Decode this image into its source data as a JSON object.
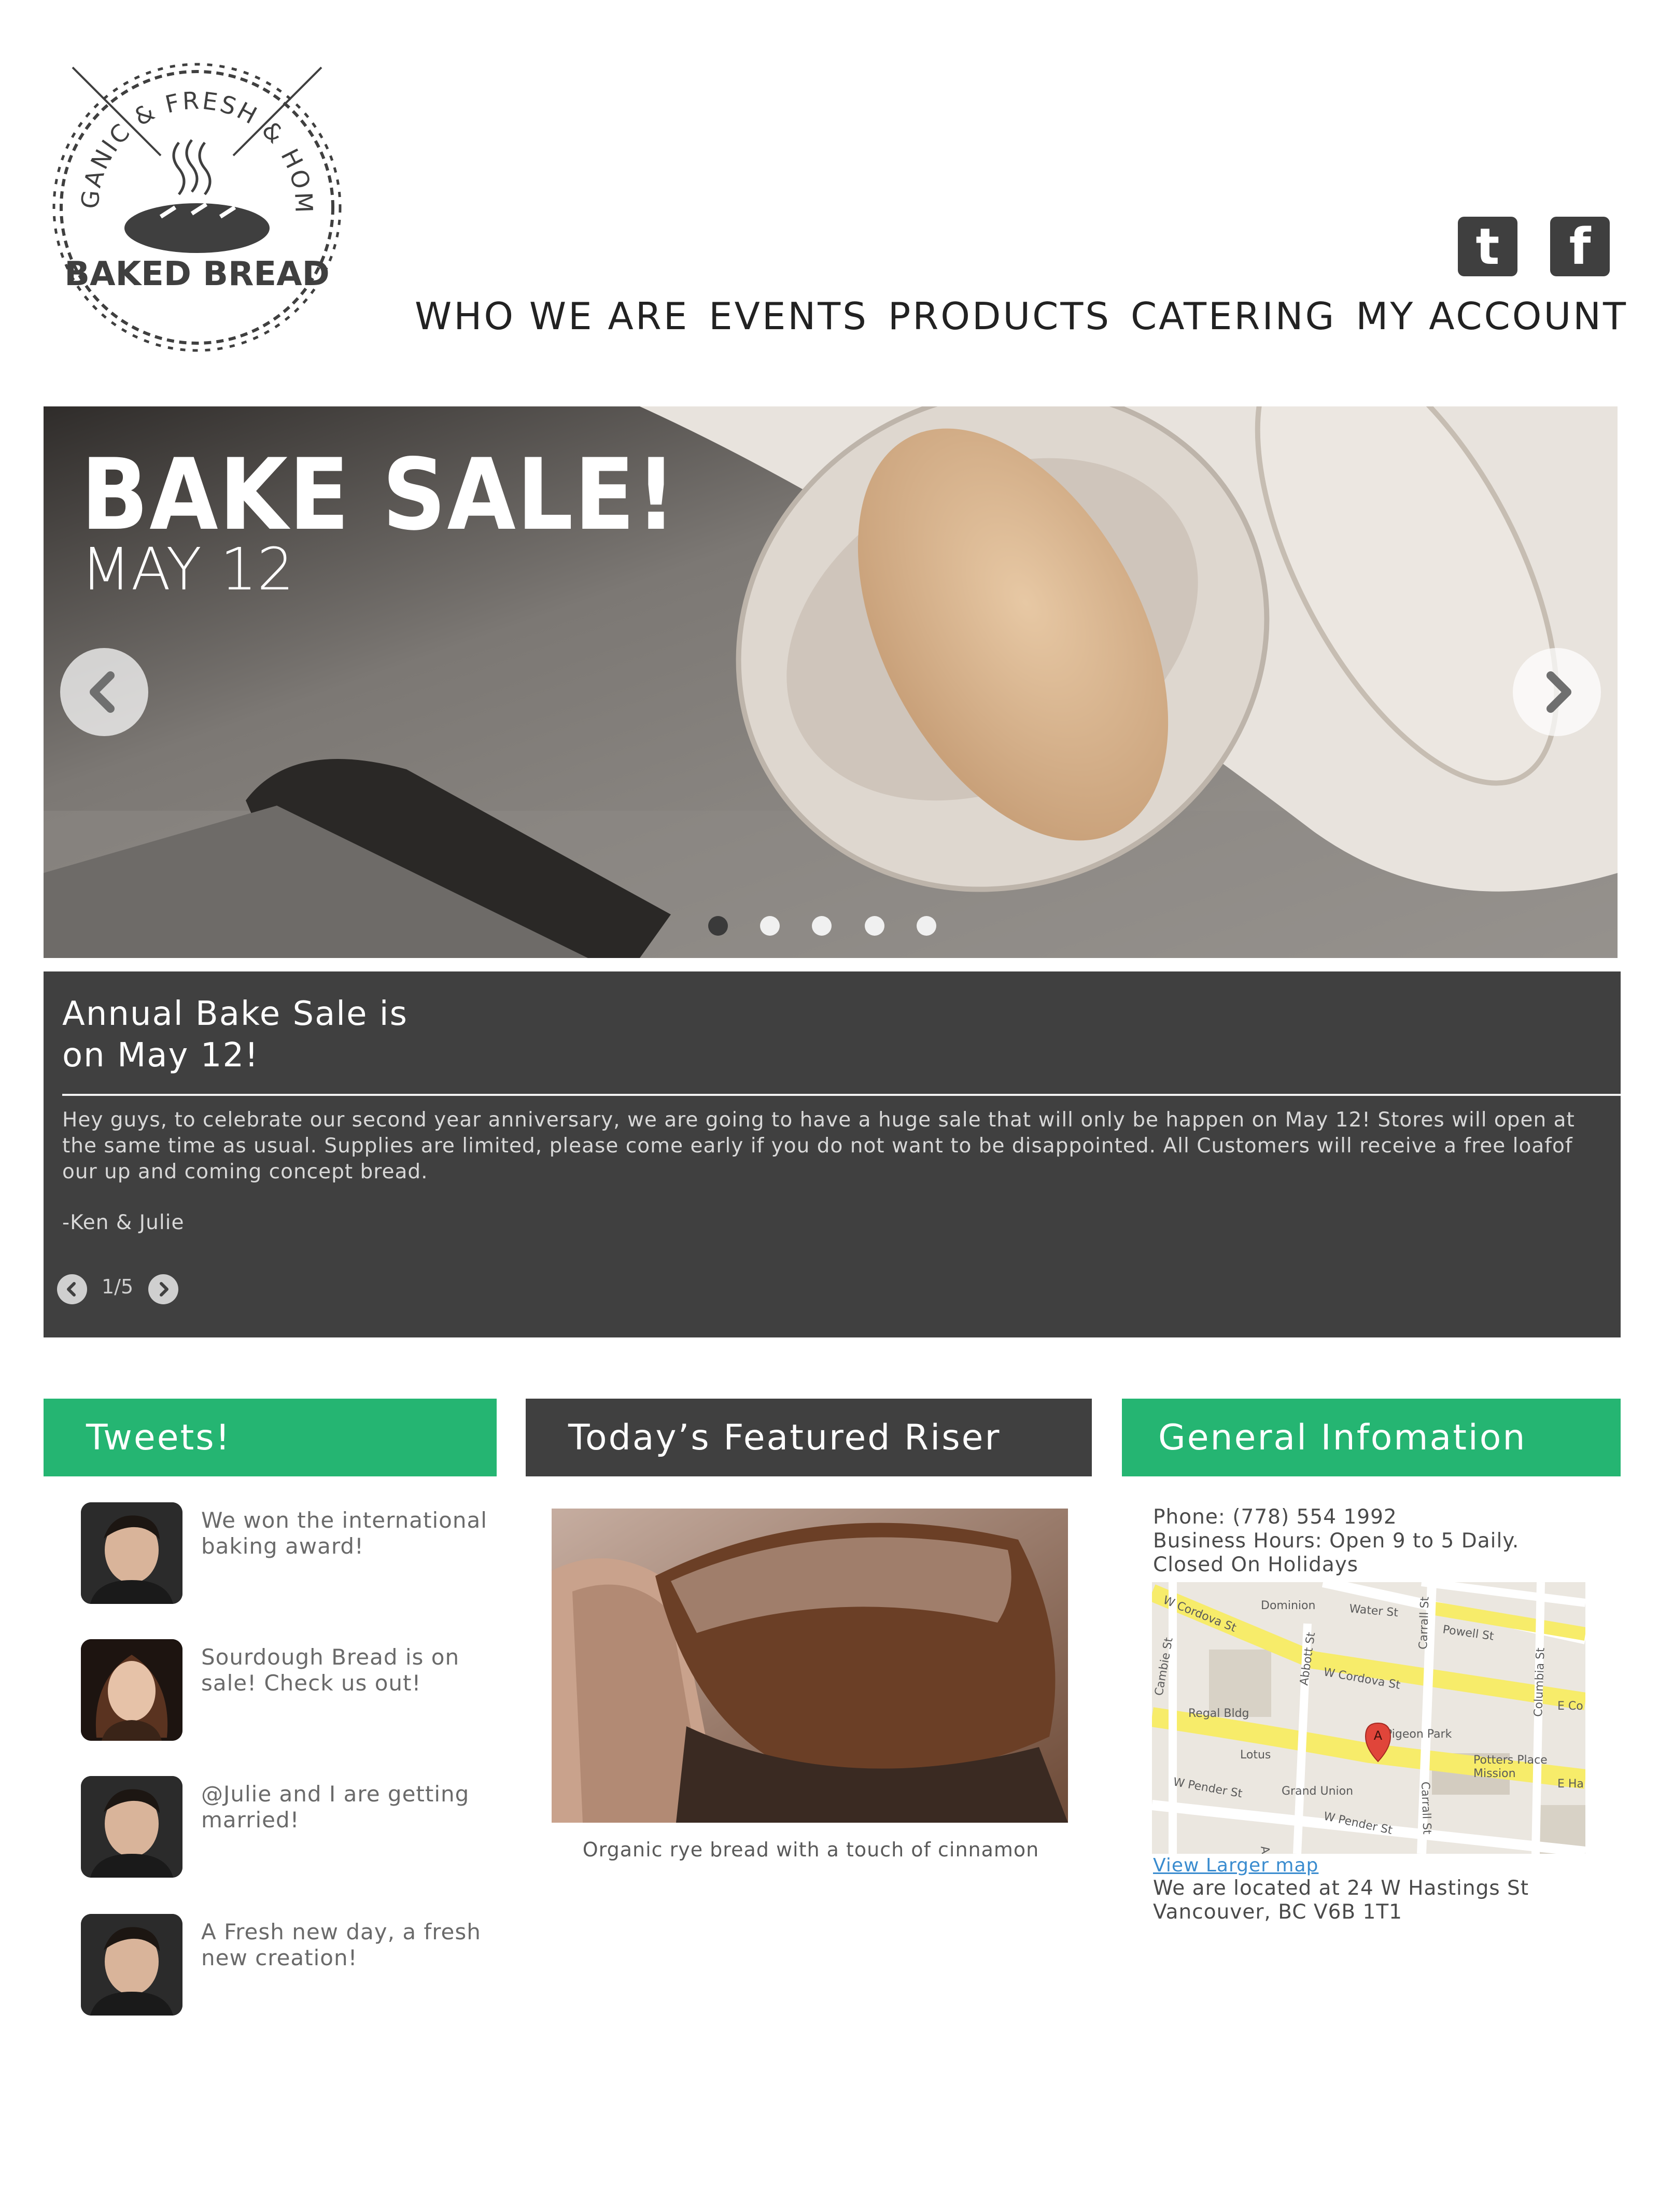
{
  "logo": {
    "arc_text": "ORGANIC & FRESH & HOMEY",
    "name": "BAKED BREAD"
  },
  "social": {
    "twitter_glyph": "t",
    "facebook_glyph": "f"
  },
  "nav": {
    "items": [
      {
        "label": "WHO WE ARE"
      },
      {
        "label": "EVENTS"
      },
      {
        "label": "PRODUCTS"
      },
      {
        "label": "CATERING"
      },
      {
        "label": "MY ACCOUNT"
      }
    ]
  },
  "hero": {
    "title": "BAKE SALE!",
    "date": "MAY 12",
    "slide_count": 5,
    "active_slide": 1
  },
  "news": {
    "title_line1": "Annual Bake Sale is",
    "title_line2": "on May 12!",
    "body": "Hey guys, to celebrate our second year anniversary, we are going to have a huge sale that will only be happen on May 12! Stores will open at the same time as usual. Supplies are limited, please come early if you do not want to be disappointed. All Customers will receive a free loafof our up and coming concept bread.",
    "signature": "-Ken & Julie",
    "counter": "1/5"
  },
  "tweets": {
    "heading": "Tweets!",
    "items": [
      {
        "text": "We won the international baking award!"
      },
      {
        "text": "Sourdough Bread is on sale! Check us out!"
      },
      {
        "text": "@Julie and I are getting married!"
      },
      {
        "text": "A Fresh new day, a fresh new creation!"
      }
    ]
  },
  "featured": {
    "heading": "Today’s Featured Riser",
    "caption": "Organic rye bread with a touch of cinnamon"
  },
  "info": {
    "heading": "General Infomation",
    "phone": "Phone: (778) 554 1992",
    "hours": "Business Hours: Open 9 to 5 Daily.",
    "closed": "Closed On Holidays",
    "map_link": "View Larger map",
    "address_line1": "We are located at 24 W Hastings St",
    "address_line2": "Vancouver, BC V6B 1T1",
    "map_labels": {
      "water_st": "Water St",
      "powell_st": "Powell St",
      "cordova_1": "W Cordova St",
      "cordova_2": "W Cordova St",
      "dominion": "Dominion",
      "regal": "Regal Bldg",
      "lotus": "Lotus",
      "grand_union": "Grand Union",
      "pigeon": "Pigeon Park",
      "potters": "Potters Place",
      "mission": "Mission",
      "pender_1": "W Pender St",
      "pender_2": "W Pender St",
      "cambie": "Cambie St",
      "abbott_1": "Abbott St",
      "abbott_2": "Abbott St",
      "carrall_1": "Carrall St",
      "carrall_2": "Carrall St",
      "columbia": "Columbia St",
      "e_co": "E Co",
      "e_ha": "E Ha",
      "marker": "A"
    }
  },
  "colors": {
    "accent_green": "#25b572",
    "panel_dark": "#404040",
    "link_blue": "#3a8ccf"
  }
}
